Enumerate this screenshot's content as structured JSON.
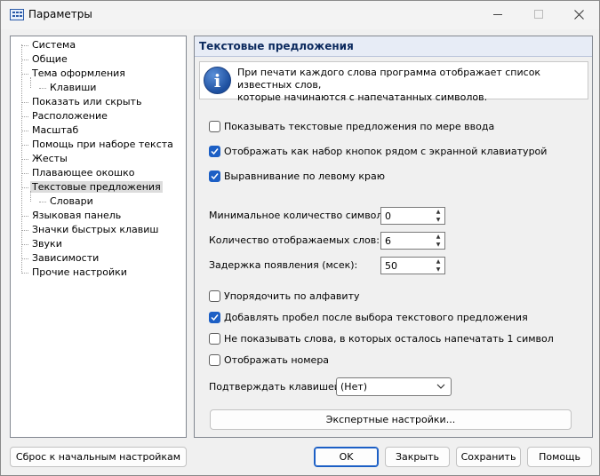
{
  "window": {
    "title": "Параметры"
  },
  "tree": {
    "items": [
      {
        "label": "Система",
        "level": 0
      },
      {
        "label": "Общие",
        "level": 0
      },
      {
        "label": "Тема оформления",
        "level": 0
      },
      {
        "label": "Клавиши",
        "level": 1
      },
      {
        "label": "Показать или скрыть",
        "level": 0
      },
      {
        "label": "Расположение",
        "level": 0
      },
      {
        "label": "Масштаб",
        "level": 0
      },
      {
        "label": "Помощь при наборе текста",
        "level": 0
      },
      {
        "label": "Жесты",
        "level": 0
      },
      {
        "label": "Плавающее окошко",
        "level": 0
      },
      {
        "label": "Текстовые предложения",
        "level": 0,
        "selected": true
      },
      {
        "label": "Словари",
        "level": 1
      },
      {
        "label": "Языковая панель",
        "level": 0
      },
      {
        "label": "Значки быстрых клавиш",
        "level": 0
      },
      {
        "label": "Звуки",
        "level": 0
      },
      {
        "label": "Зависимости",
        "level": 0
      },
      {
        "label": "Прочие настройки",
        "level": 0
      }
    ]
  },
  "panel": {
    "header": "Текстовые предложения",
    "info_line1": "При печати каждого слова программа отображает список известных слов,",
    "info_line2": "которые начинаются с напечатанных символов.",
    "show_suggestions": {
      "label": "Показывать текстовые предложения по мере ввода",
      "checked": false
    },
    "as_buttons": {
      "label": "Отображать как набор кнопок рядом с экранной клавиатурой",
      "checked": true
    },
    "align_left": {
      "label": "Выравнивание по левому краю",
      "checked": true
    },
    "min_chars": {
      "label": "Минимальное количество символов:",
      "value": "0"
    },
    "words_count": {
      "label": "Количество отображаемых слов:",
      "value": "6"
    },
    "delay": {
      "label": "Задержка появления (мсек):",
      "value": "50"
    },
    "sort_alpha": {
      "label": "Упорядочить по алфавиту",
      "checked": false
    },
    "add_space": {
      "label": "Добавлять пробел после выбора текстового предложения",
      "checked": true
    },
    "hide_one_left": {
      "label": "Не показывать слова, в которых осталось напечатать 1 символ",
      "checked": false
    },
    "show_numbers": {
      "label": "Отображать номера",
      "checked": false
    },
    "confirm_key": {
      "label": "Подтверждать клавишей:",
      "value": "(Нет)"
    },
    "expert_button": "Экспертные настройки..."
  },
  "footer": {
    "reset": "Сброс к начальным настройкам",
    "ok": "OK",
    "close": "Закрыть",
    "save": "Сохранить",
    "help": "Помощь"
  },
  "colors": {
    "accent": "#1c5fc5",
    "header_bg": "#e7ecf6",
    "header_text": "#0c2a5e"
  }
}
